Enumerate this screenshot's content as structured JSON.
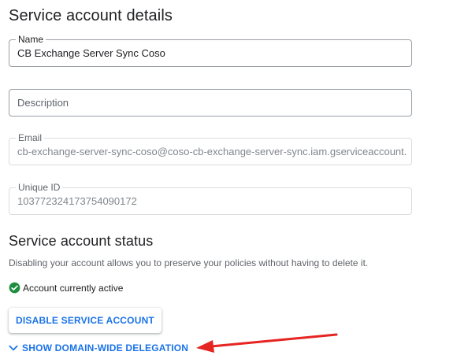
{
  "details": {
    "title": "Service account details",
    "name": {
      "label": "Name",
      "value": "CB Exchange Server Sync Coso"
    },
    "description": {
      "placeholder": "Description",
      "value": ""
    },
    "email": {
      "label": "Email",
      "value": "cb-exchange-server-sync-coso@coso-cb-exchange-server-sync.iam.gserviceaccount.com"
    },
    "unique_id": {
      "label": "Unique ID",
      "value": "103772324173754090172"
    }
  },
  "status": {
    "title": "Service account status",
    "helper": "Disabling your account allows you to preserve your policies without having to delete it.",
    "active_text": "Account currently active",
    "disable_button": "DISABLE SERVICE ACCOUNT",
    "delegation_toggle": "SHOW DOMAIN-WIDE DELEGATION"
  },
  "colors": {
    "accent": "#1a73e8",
    "success": "#1e8e3e",
    "annotation": "#e52521"
  },
  "icons": {
    "active": "check-circle-icon",
    "toggle": "chevron-down-icon",
    "annotation": "red-arrow"
  }
}
